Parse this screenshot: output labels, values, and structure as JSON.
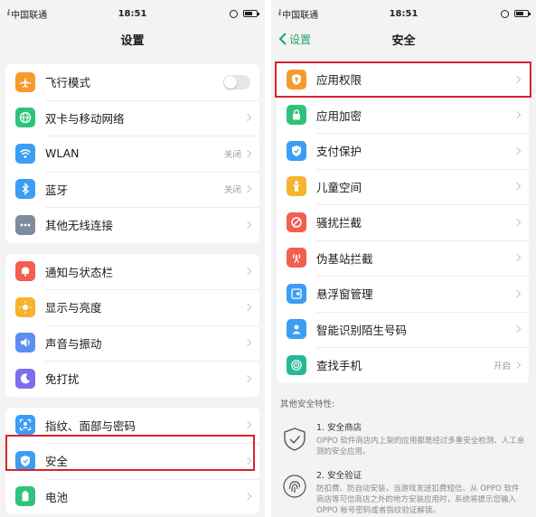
{
  "left": {
    "status": {
      "signal": "ྔྔl",
      "carrier": "中国联通",
      "time": "18:51"
    },
    "title": "设置",
    "groups": [
      [
        {
          "label": "飞行模式",
          "icon": "airplane-icon",
          "color": "#f79a2c",
          "toggle": "off"
        },
        {
          "label": "双卡与移动网络",
          "icon": "globe-icon",
          "color": "#2fc27a"
        },
        {
          "label": "WLAN",
          "icon": "wifi-icon",
          "color": "#3b9df5",
          "value": "关闭"
        },
        {
          "label": "蓝牙",
          "icon": "bluetooth-icon",
          "color": "#3b9df5",
          "value": "关闭"
        },
        {
          "label": "其他无线连接",
          "icon": "more-dots-icon",
          "color": "#7f8c9d"
        }
      ],
      [
        {
          "label": "通知与状态栏",
          "icon": "bell-icon",
          "color": "#f25f4f"
        },
        {
          "label": "显示与亮度",
          "icon": "sun-icon",
          "color": "#f6b32b"
        },
        {
          "label": "声音与振动",
          "icon": "speaker-icon",
          "color": "#5b8ff0"
        },
        {
          "label": "免打扰",
          "icon": "moon-icon",
          "color": "#7f6df0"
        }
      ],
      [
        {
          "label": "指纹、面部与密码",
          "icon": "face-id-icon",
          "color": "#3b9df5"
        },
        {
          "label": "安全",
          "icon": "shield-icon",
          "color": "#3b9df5"
        },
        {
          "label": "电池",
          "icon": "battery-icon",
          "color": "#2fc27a"
        }
      ]
    ]
  },
  "right": {
    "status": {
      "signal": "ྔྔl",
      "carrier": "中国联通",
      "time": "18:51"
    },
    "back": "设置",
    "title": "安全",
    "items": [
      {
        "label": "应用权限",
        "icon": "shield-key-icon",
        "color": "#f79a2c"
      },
      {
        "label": "应用加密",
        "icon": "lock-icon",
        "color": "#2fc27a"
      },
      {
        "label": "支付保护",
        "icon": "shield-check-icon",
        "color": "#3b9df5"
      },
      {
        "label": "儿童空间",
        "icon": "child-icon",
        "color": "#f6b32b"
      },
      {
        "label": "骚扰拦截",
        "icon": "block-icon",
        "color": "#f25f4f"
      },
      {
        "label": "伪基站拦截",
        "icon": "antenna-icon",
        "color": "#f25f4f"
      },
      {
        "label": "悬浮窗管理",
        "icon": "floating-window-icon",
        "color": "#3b9df5"
      },
      {
        "label": "智能识别陌生号码",
        "icon": "contact-icon",
        "color": "#3b9df5"
      },
      {
        "label": "查找手机",
        "icon": "radar-icon",
        "color": "#25b89a",
        "value": "开启"
      }
    ],
    "other_title": "其他安全特性:",
    "features": [
      {
        "title": "1. 安全商店",
        "desc": "OPPO 软件商店内上架的应用都是经过多重安全检测、人工亲测的安全应用。",
        "icon": "shield-outline-icon"
      },
      {
        "title": "2. 安全验证",
        "desc": "防扣费、防自动安装，当游戏发送扣费短信、从 OPPO 软件商店等可信商店之外的地方安装应用时，系统将提示您输入 OPPO 帐号密码或者指纹验证解锁。",
        "icon": "fingerprint-icon"
      }
    ]
  }
}
